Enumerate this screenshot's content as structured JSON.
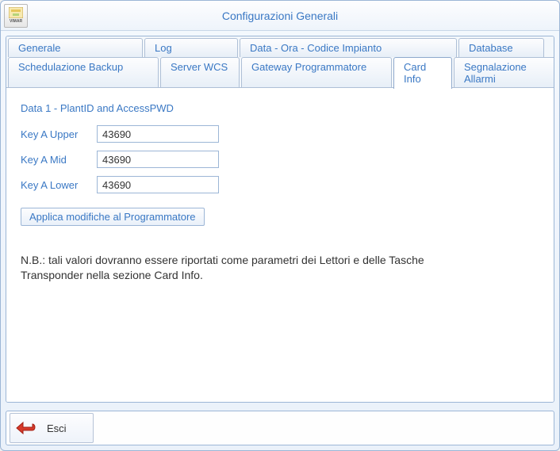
{
  "window": {
    "title": "Configurazioni Generali",
    "logo_label": "VIMAR"
  },
  "tabs_row1": {
    "generale": "Generale",
    "log": "Log",
    "data_ora": "Data - Ora - Codice Impianto",
    "database": "Database"
  },
  "tabs_row2": {
    "schedulazione": "Schedulazione Backup",
    "server_wcs": "Server WCS",
    "gateway": "Gateway Programmatore",
    "card_info": "Card Info",
    "segnalazione": "Segnalazione Allarmi"
  },
  "card_info": {
    "section_title": "Data 1 - PlantID and AccessPWD",
    "fields": {
      "key_a_upper": {
        "label": "Key A Upper",
        "value": "43690"
      },
      "key_a_mid": {
        "label": "Key A Mid",
        "value": "43690"
      },
      "key_a_lower": {
        "label": "Key A Lower",
        "value": "43690"
      }
    },
    "apply_button": "Applica modifiche al Programmatore",
    "note": "N.B.: tali valori dovranno essere riportati come parametri dei Lettori e delle Tasche Transponder nella sezione Card Info."
  },
  "footer": {
    "exit": "Esci"
  }
}
